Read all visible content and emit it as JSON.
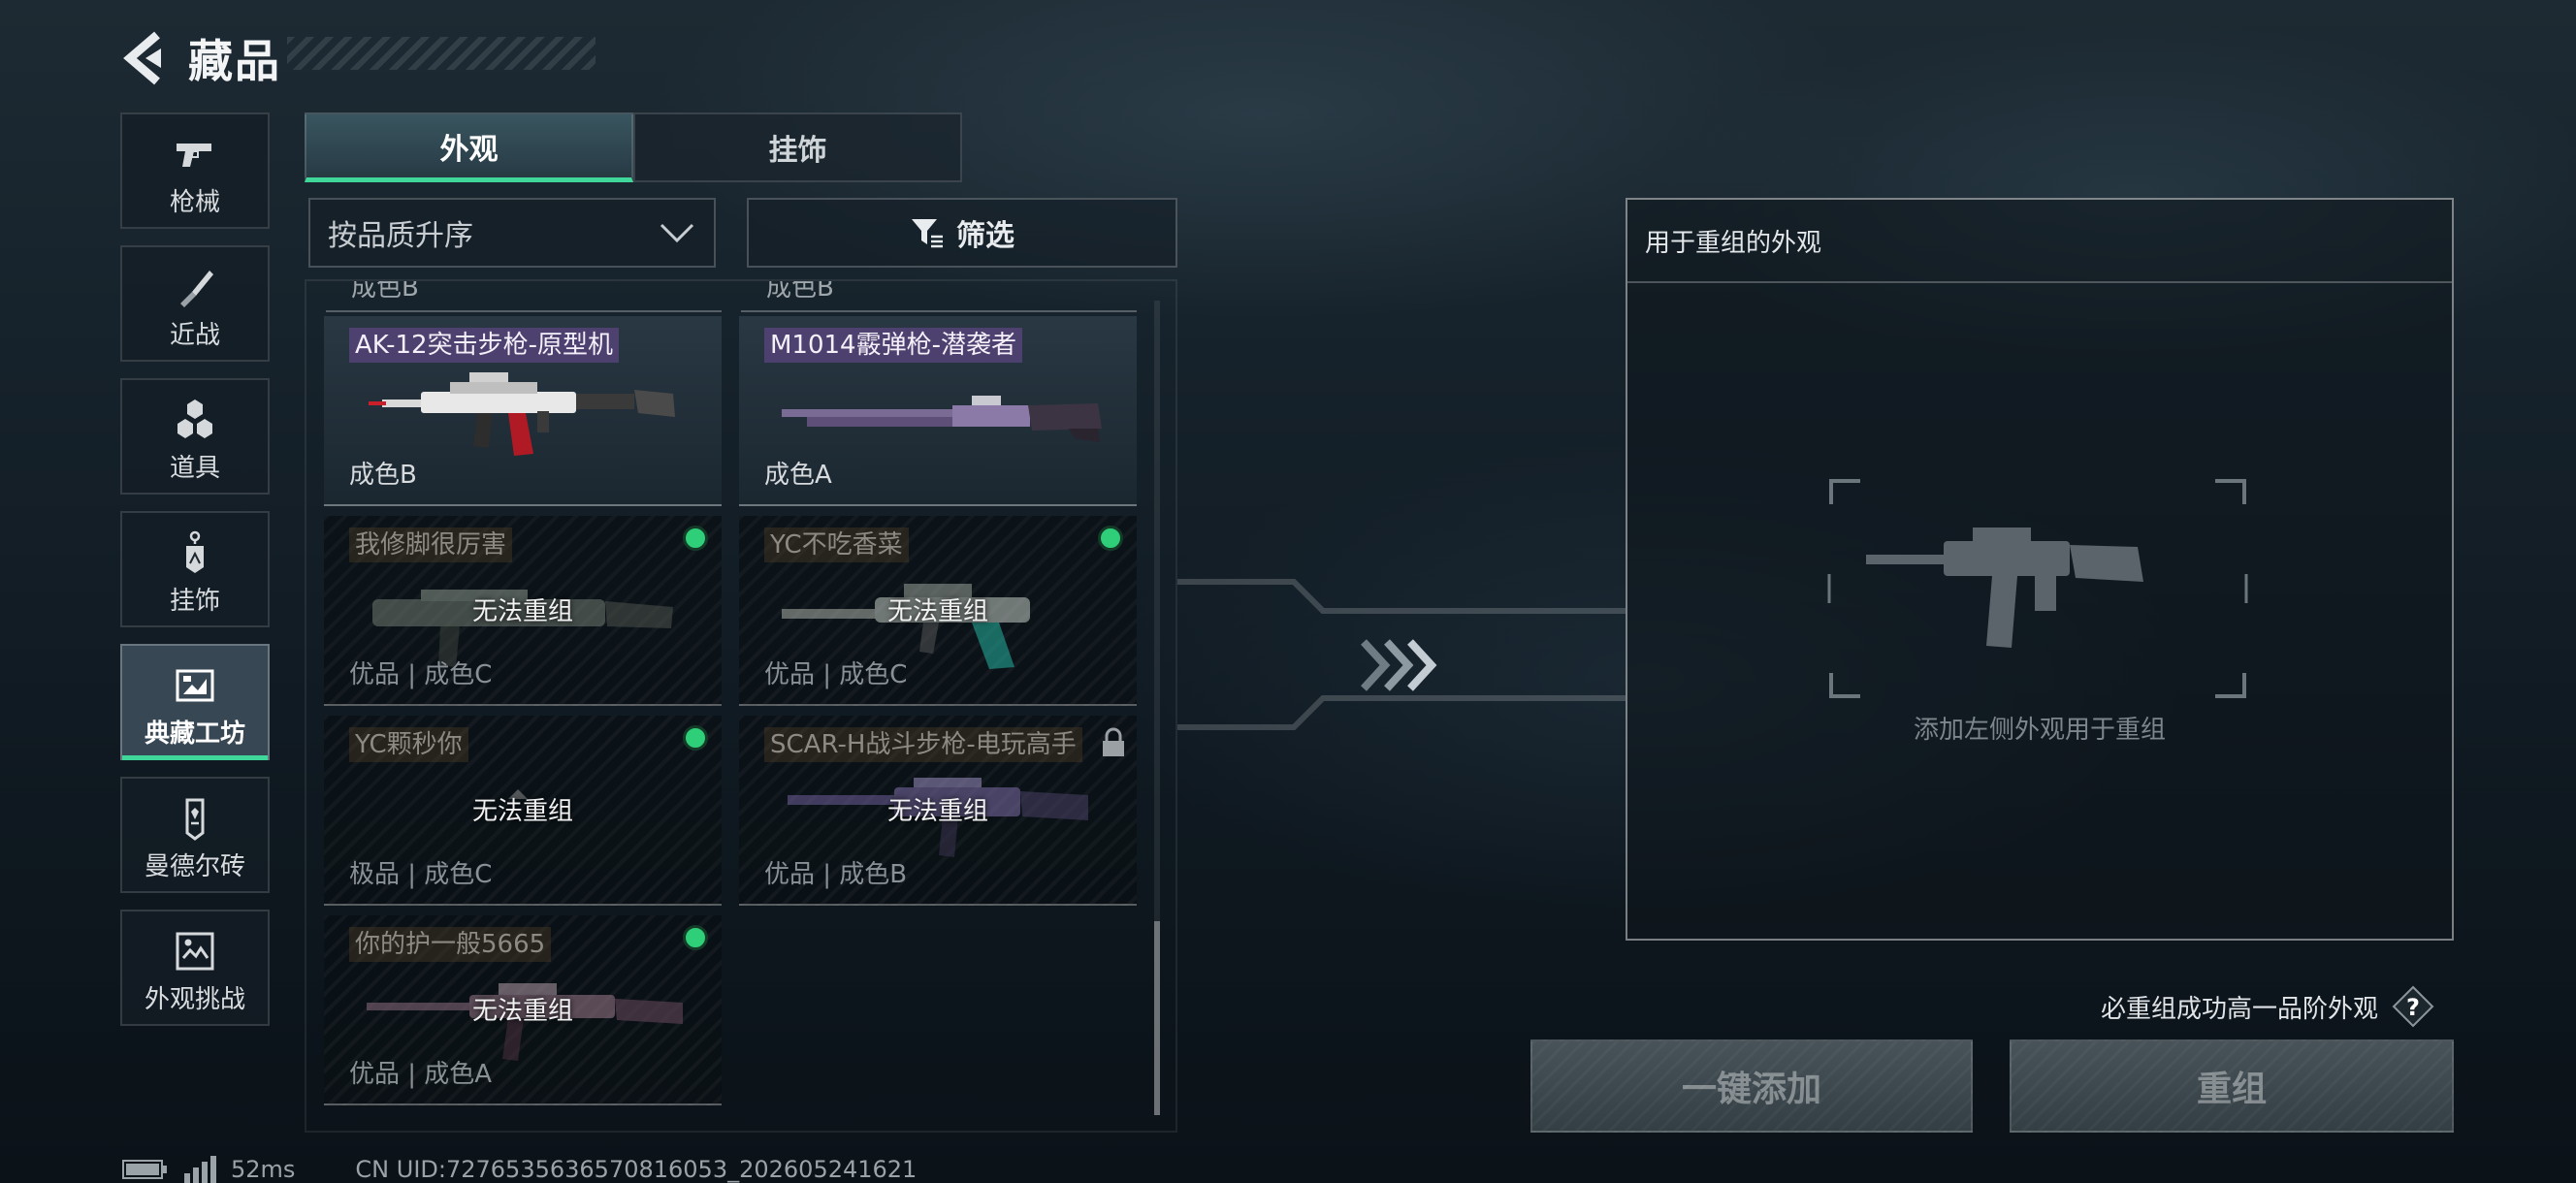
{
  "header": {
    "title": "藏品"
  },
  "sidebar": {
    "items": [
      {
        "label": "枪械",
        "icon": "pistol-icon"
      },
      {
        "label": "近战",
        "icon": "knife-icon"
      },
      {
        "label": "道具",
        "icon": "hexagon-items-icon"
      },
      {
        "label": "挂饰",
        "icon": "charm-tag-icon"
      },
      {
        "label": "典藏工坊",
        "icon": "workshop-frame-icon",
        "active": true
      },
      {
        "label": "曼德尔砖",
        "icon": "mandel-brick-icon"
      },
      {
        "label": "外观挑战",
        "icon": "challenge-icon"
      }
    ]
  },
  "tabs": [
    {
      "label": "外观",
      "active": true
    },
    {
      "label": "挂饰",
      "active": false
    }
  ],
  "sort": {
    "label": "按品质升序"
  },
  "filter": {
    "label": "筛选"
  },
  "grid": {
    "partial_top": [
      "成色B",
      "成色B"
    ],
    "items": [
      {
        "name": "AK-12突击步枪-原型机",
        "footer": "成色B",
        "state": "available"
      },
      {
        "name": "M1014霰弹枪-潜袭者",
        "footer": "成色A",
        "state": "available"
      },
      {
        "name": "我修脚很厉害",
        "footer": "优品 | 成色C",
        "state": "equipped",
        "overlay": "无法重组"
      },
      {
        "name": "YC不吃香菜",
        "footer": "优品 | 成色C",
        "state": "equipped",
        "overlay": "无法重组"
      },
      {
        "name": "YC颗秒你",
        "footer": "极品 | 成色C",
        "state": "equipped",
        "overlay": "无法重组"
      },
      {
        "name": "SCAR-H战斗步枪-电玩高手",
        "footer": "优品 | 成色B",
        "state": "locked",
        "overlay": "无法重组"
      },
      {
        "name": "你的护一般5665",
        "footer": "优品 | 成色A",
        "state": "equipped",
        "overlay": "无法重组"
      }
    ]
  },
  "recombine_panel": {
    "title": "用于重组的外观",
    "hint": "添加左侧外观用于重组"
  },
  "guarantee": {
    "text": "必重组成功高一品阶外观",
    "help_icon": "question-mark-icon"
  },
  "buttons": {
    "add_all": "一键添加",
    "recombine": "重组"
  },
  "status": {
    "ping": "52ms",
    "uid": "CN UID:7276535636570816053_202605241621"
  },
  "colors": {
    "accent": "#3fd89a",
    "status_dot": "#2fcf7a",
    "name_tag": "#6e4b96"
  }
}
